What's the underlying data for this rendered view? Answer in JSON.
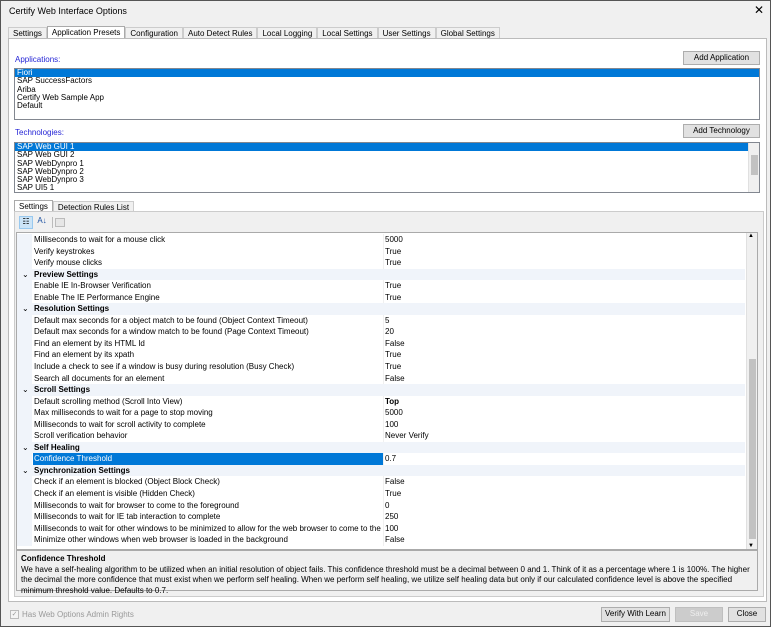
{
  "window": {
    "title": "Certify Web Interface Options",
    "close": "✕"
  },
  "tabs": [
    "Settings",
    "Application Presets",
    "Configuration",
    "Auto Detect Rules",
    "Local Logging",
    "Local Settings",
    "User Settings",
    "Global Settings"
  ],
  "applications": {
    "label": "Applications:",
    "add_button": "Add Application",
    "items": [
      "Fiori",
      "SAP SuccessFactors",
      "Ariba",
      "Certify Web Sample App",
      "Default"
    ],
    "selected": 0
  },
  "technologies": {
    "label": "Technologies:",
    "add_button": "Add Technology",
    "items": [
      "SAP Web GUI 1",
      "SAP Web GUI 2",
      "SAP WebDynpro 1",
      "SAP WebDynpro 2",
      "SAP WebDynpro 3",
      "SAP UI5 1"
    ],
    "selected": 0
  },
  "inner_tabs": [
    "Settings",
    "Detection Rules List"
  ],
  "grid": {
    "rows": [
      {
        "name": "Milliseconds to wait for a mouse click",
        "value": "5000"
      },
      {
        "name": "Verify keystrokes",
        "value": "True"
      },
      {
        "name": "Verify mouse clicks",
        "value": "True"
      },
      {
        "category": "Preview Settings"
      },
      {
        "name": "Enable IE In-Browser Verification",
        "value": "True"
      },
      {
        "name": "Enable The IE Performance Engine",
        "value": "True"
      },
      {
        "category": "Resolution Settings"
      },
      {
        "name": "Default max seconds for a object match to be found (Object Context Timeout)",
        "value": "5"
      },
      {
        "name": "Default max seconds for a window match to be found (Page Context Timeout)",
        "value": "20"
      },
      {
        "name": "Find an element by its HTML Id",
        "value": "False"
      },
      {
        "name": "Find an element by its xpath",
        "value": "True"
      },
      {
        "name": "Include a check to see if a window is busy during resolution (Busy Check)",
        "value": "True"
      },
      {
        "name": "Search all documents for an element",
        "value": "False"
      },
      {
        "category": "Scroll Settings"
      },
      {
        "name": "Default scrolling method (Scroll Into View)",
        "value": "Top",
        "bold": true
      },
      {
        "name": "Max milliseconds to wait for a page to stop moving",
        "value": "5000"
      },
      {
        "name": "Milliseconds to wait for scroll activity to complete",
        "value": "100"
      },
      {
        "name": "Scroll verification behavior",
        "value": "Never Verify"
      },
      {
        "category": "Self Healing"
      },
      {
        "name": "Confidence Threshold",
        "value": "0.7",
        "selected": true
      },
      {
        "category": "Synchronization Settings"
      },
      {
        "name": "Check if an element is blocked (Object Block Check)",
        "value": "False"
      },
      {
        "name": "Check if an element is visible (Hidden Check)",
        "value": "True"
      },
      {
        "name": "Milliseconds to wait for browser to come to the foreground",
        "value": "0"
      },
      {
        "name": "Milliseconds to wait for IE tab interaction to complete",
        "value": "250"
      },
      {
        "name": "Milliseconds to wait for other windows to be minimized to allow for the web browser to come to the foregro",
        "value": "100"
      },
      {
        "name": "Minimize other windows when web browser is loaded in the background",
        "value": "False"
      }
    ]
  },
  "description": {
    "title": "Confidence Threshold",
    "text": "We have a self-healing algorithm to be utilized when an initial resolution of object fails.  This confidence threshold must be a decimal between 0 and 1.  Think of it as a percentage where 1 is 100%.  The higher the decimal the more confidence that must exist when we perform self healing.  When we perform self healing, we utilize self healing data but only if our calculated confidence level is above the specified minimum threshold value. Defaults to 0.7."
  },
  "footer": {
    "admin_rights": "Has Web Options Admin Rights",
    "admin_checked": true,
    "verify": "Verify With Learn",
    "save": "Save",
    "close": "Close"
  },
  "colors": {
    "selection": "#0078d7",
    "label": "#2525d6"
  }
}
